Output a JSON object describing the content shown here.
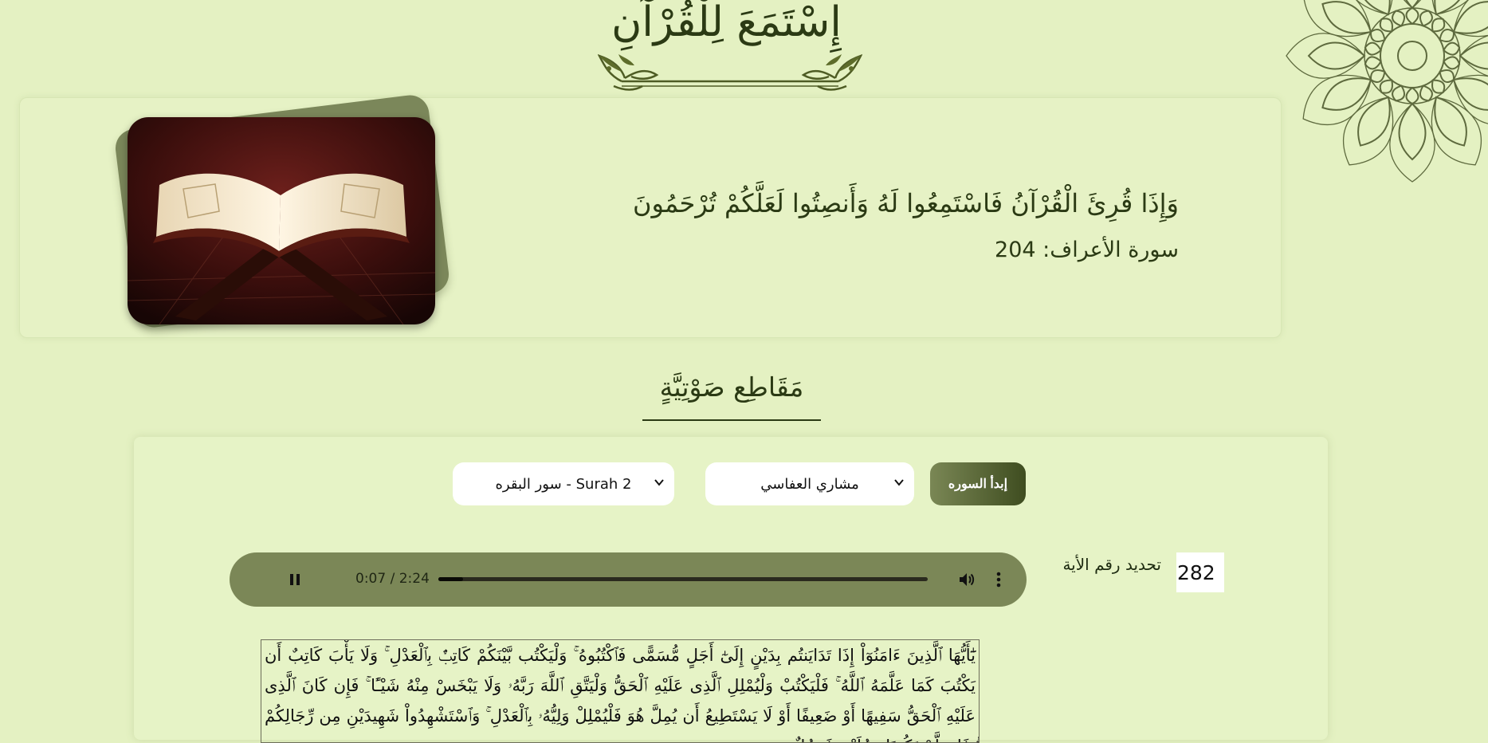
{
  "header": {
    "site_title": "إِسْتَمَعَ لِلْقُرْآنِ"
  },
  "hero": {
    "verse": "وَإِذَا قُرِئَ الْقُرْآنُ فَاسْتَمِعُوا لَهُ وَأَنصِتُوا لَعَلَّكُمْ تُرْحَمُونَ",
    "reference": "سورة الأعراف: 204"
  },
  "audio_section": {
    "title": "مَقَاطِع صَوْتِيَّةٍ",
    "surah_select": {
      "selected": "Surah 2 - سور البقره"
    },
    "reciter_select": {
      "selected": "مشاري العفاسي"
    },
    "start_button_label": "إبدأ السوره",
    "ayah_label": "تحديد رقم الأية",
    "ayah_number": "282",
    "player": {
      "time": "0:07 / 2:24",
      "progress": 0.05
    },
    "ayah_text": "يَٰٓأَيُّهَا ٱلَّذِينَ ءَامَنُوٓاْ إِذَا تَدَايَنتُم بِدَيْنٍ إِلَىٰٓ أَجَلٍ مُّسَمًّى فَٱكْتُبُوهُ ۚ وَلْيَكْتُب بَّيْنَكُمْ كَاتِبٌۢ بِٱلْعَدْلِ ۚ وَلَا يَأْبَ كَاتِبٌ أَن يَكْتُبَ كَمَا عَلَّمَهُ ٱللَّهُ ۚ فَلْيَكْتُبْ وَلْيُمْلِلِ ٱلَّذِى عَلَيْهِ ٱلْحَقُّ وَلْيَتَّقِ ٱللَّهَ رَبَّهُۥ وَلَا يَبْخَسْ مِنْهُ شَيْـًٔا ۚ فَإِن كَانَ ٱلَّذِى عَلَيْهِ ٱلْحَقُّ سَفِيهًا أَوْ ضَعِيفًا أَوْ لَا يَسْتَطِيعُ أَن يُمِلَّ هُوَ فَلْيُمْلِلْ وَلِيُّهُۥ بِٱلْعَدْلِ ۚ وَٱسْتَشْهِدُواْ شَهِيدَيْنِ مِن رِّجَالِكُمْ ۖ فَإِن لَّمْ يَكُونَا رَجُلَيْنِ فَرَجُلٌ"
  },
  "icons": {
    "ornament": "floral-divider-icon",
    "mandala": "mandala-ornament-icon",
    "pause": "pause-icon",
    "volume": "volume-icon",
    "more": "more-vertical-icon",
    "chevron": "chevron-down-icon"
  },
  "colors": {
    "background": "#e4f1c2",
    "accent_dark": "#3f4d20",
    "accent": "#7b8757",
    "text": "#2b3a14"
  }
}
